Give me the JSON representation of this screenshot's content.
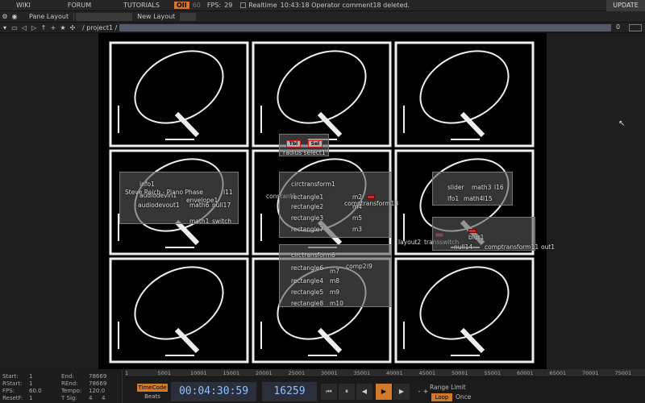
{
  "menu": {
    "wiki": "WIKI",
    "forum": "FORUM",
    "tutorials": "TUTORIALS",
    "oi": "OII",
    "oi_count": "60",
    "fps_label": "FPS:",
    "fps_value": "29",
    "realtime": "Realtime",
    "message": "10:43:18 Operator comment18 deleted.",
    "update": "UPDATE"
  },
  "toolbar": {
    "pane_layout": "Pane Layout",
    "new_layout": "New Layout"
  },
  "pathbar": {
    "path": "/ project1 / >>",
    "zero": "0"
  },
  "nodes": {
    "radius_select": "radius select1",
    "tbl": "Tbl",
    "sel": "Sel",
    "info": "info1",
    "steve": "Steve Reich - Piano Phase",
    "audiodevin": "audiodevin1",
    "envelope": "envelope1",
    "audiodevout": "audiodevout1",
    "math6": "math6",
    "null17": "null17",
    "l11": "l11",
    "math1": "math1",
    "switch": "switch",
    "constant1": "constant1",
    "circ1": "circtransform1",
    "rect1": "rectangle1",
    "m2": "m2",
    "rect2": "rectangle2",
    "m4": "m4",
    "rect3": "rectangle3",
    "m5": "m5",
    "rect7": "rectangle7",
    "m3": "m3",
    "comp13": "comptransform13",
    "slider": "slider",
    "math3": "math3",
    "l16": "l16",
    "lfo1": "lfo1",
    "math4": "math4",
    "l15": "l15",
    "layout2": "layout2",
    "transswitch": "transswitch",
    "null14": "null14",
    "blur1": "blur1",
    "comp11": "comptransform11",
    "out1": "out1",
    "circ6": "circtransform6",
    "rect6": "rectangle6",
    "m7": "m7",
    "comp2": "comp2",
    "l9": "l9",
    "rect4": "rectangle4",
    "m8": "m8",
    "rect5": "rectangle5",
    "m9": "m9",
    "rect8": "rectangle8",
    "m10": "m10"
  },
  "ruler": [
    "1",
    "5001",
    "10001",
    "15001",
    "20001",
    "25001",
    "30001",
    "35001",
    "40001",
    "45001",
    "50001",
    "55001",
    "60001",
    "65001",
    "70001",
    "75001"
  ],
  "stats": {
    "start_l": "Start:",
    "start_v": "1",
    "end_l": "End:",
    "end_v": "78669",
    "rstart_l": "RStart:",
    "rstart_v": "1",
    "rend_l": "REnd:",
    "rend_v": "78669",
    "fps_l": "FPS:",
    "fps_v": "60.0",
    "tempo_l": "Tempo:",
    "tempo_v": "120.0",
    "resetf_l": "ResetF:",
    "resetf_v": "1",
    "tsig_l": "T Sig:",
    "tsig_a": "4",
    "tsig_b": "4"
  },
  "transport": {
    "timecode": "TimeCode",
    "beats": "Beats",
    "time": "00:04:30:59",
    "frame": "16259",
    "minus": "-",
    "plus": "+",
    "range_limit": "Range Limit",
    "loop": "Loop",
    "once": "Once"
  }
}
